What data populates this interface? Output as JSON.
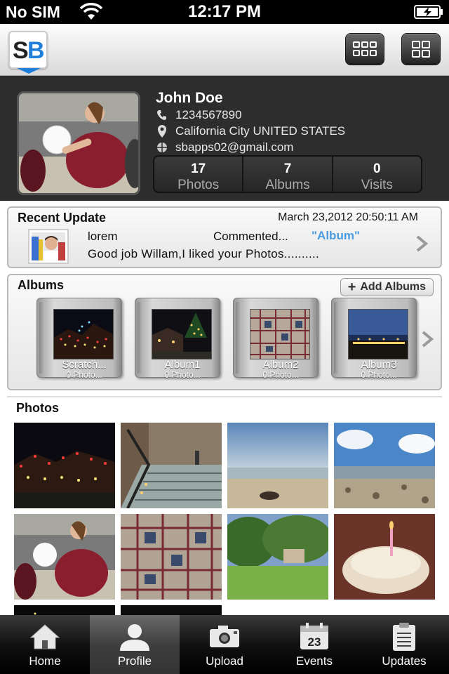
{
  "status_bar": {
    "carrier": "No SIM",
    "time": "12:17 PM"
  },
  "header": {
    "logo_s": "S",
    "logo_b": "B"
  },
  "profile": {
    "name": "John Doe",
    "phone": "1234567890",
    "location": "California City UNITED STATES",
    "email": "sbapps02@gmail.com",
    "stats": [
      {
        "value": "17",
        "label": "Photos"
      },
      {
        "value": "7",
        "label": "Albums"
      },
      {
        "value": "0",
        "label": "Visits"
      }
    ]
  },
  "recent_update": {
    "title": "Recent Update",
    "date": "March 23,2012 20:50:11 AM",
    "user": "lorem",
    "action": "Commented...",
    "target": "\"Album\"",
    "message": "Good job Willam,I liked your Photos.........."
  },
  "albums": {
    "title": "Albums",
    "add_label": "Add Albums",
    "items": [
      {
        "name": "Scratch...",
        "count": "0 Photo..."
      },
      {
        "name": "Album1",
        "count": "0 Photo..."
      },
      {
        "name": "Album2",
        "count": "0 Photo..."
      },
      {
        "name": "Album3",
        "count": "0 Photo..."
      }
    ]
  },
  "photos": {
    "title": "Photos"
  },
  "tabbar": {
    "items": [
      {
        "label": "Home",
        "icon": "home-icon"
      },
      {
        "label": "Profile",
        "icon": "person-icon"
      },
      {
        "label": "Upload",
        "icon": "camera-icon"
      },
      {
        "label": "Events",
        "icon": "calendar-icon",
        "day": "23"
      },
      {
        "label": "Updates",
        "icon": "clipboard-icon"
      }
    ],
    "active": "Profile"
  }
}
